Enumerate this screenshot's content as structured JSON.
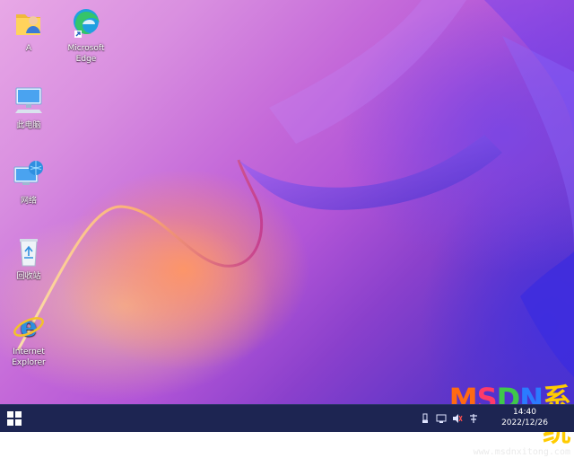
{
  "desktop": {
    "icons": [
      {
        "label": "A",
        "icon": "user-folder-icon"
      },
      {
        "label": "Microsoft\nEdge",
        "icon": "edge-icon"
      },
      {
        "label": "此电脑",
        "icon": "computer-icon"
      },
      {
        "label": "网络",
        "icon": "network-icon"
      },
      {
        "label": "回收站",
        "icon": "recycle-bin-icon"
      },
      {
        "label": "Internet\nExplorer",
        "icon": "internet-explorer-icon"
      }
    ]
  },
  "taskbar": {
    "start_icon": "windows-start-icon",
    "tray_icons": [
      "usb-icon",
      "network-tray-icon",
      "volume-icon",
      "input-method-icon"
    ],
    "clock_time": "14:40",
    "clock_date": "2022/12/26",
    "accent_color": "#1d2552"
  },
  "watermark": {
    "brand_letters": [
      "M",
      "S",
      "D",
      "N",
      "系统"
    ],
    "brand_colors": [
      "#ff6a13",
      "#ff3b6a",
      "#3fc84b",
      "#2b7bff",
      "#ffcc00"
    ],
    "site": "www.msdnxitong.com"
  }
}
